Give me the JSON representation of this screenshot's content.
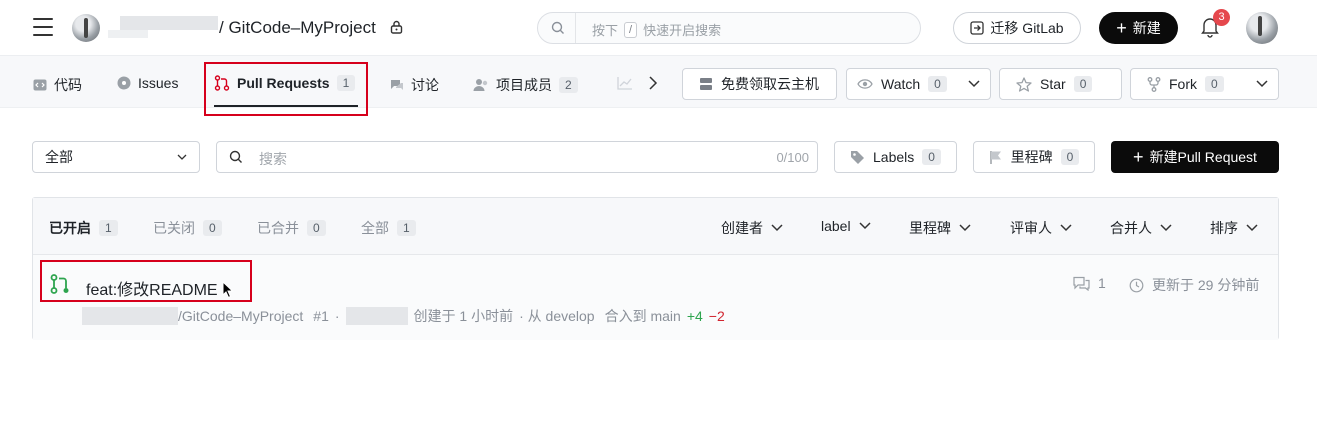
{
  "header": {
    "repo_path": "/ GitCode–MyProject",
    "search_hint_pre": "按下",
    "search_key": "/",
    "search_hint_post": "快速开启搜索",
    "migrate_label": "迁移 GitLab",
    "new_label": "新建",
    "notification_count": "3"
  },
  "tabs": {
    "code": "代码",
    "issues": "Issues",
    "pull_requests": "Pull Requests",
    "pull_requests_count": "1",
    "discuss": "讨论",
    "members": "项目成员",
    "members_count": "2"
  },
  "repo_actions": {
    "cloud_label": "免费领取云主机",
    "watch_label": "Watch",
    "watch_count": "0",
    "star_label": "Star",
    "star_count": "0",
    "fork_label": "Fork",
    "fork_count": "0"
  },
  "filters": {
    "scope_value": "全部",
    "search_placeholder": "搜索",
    "search_counter": "0/100",
    "labels_label": "Labels",
    "labels_count": "0",
    "milestone_label": "里程碑",
    "milestone_count": "0",
    "new_pr_label": "新建Pull Request"
  },
  "state_tabs": [
    {
      "label": "已开启",
      "count": "1"
    },
    {
      "label": "已关闭",
      "count": "0"
    },
    {
      "label": "已合并",
      "count": "0"
    },
    {
      "label": "全部",
      "count": "1"
    }
  ],
  "list_filters": {
    "creator": "创建者",
    "label": "label",
    "milestone": "里程碑",
    "reviewer": "评审人",
    "merger": "合并人",
    "sort": "排序"
  },
  "pull_request": {
    "title": "feat:修改README",
    "repo": "/GitCode–MyProject",
    "number": "#1",
    "sep": "·",
    "created": "创建于 1 小时前",
    "from": "· 从 develop",
    "merge_into": "合入到 main",
    "additions": "+4",
    "deletions": "−2",
    "comments": "1",
    "updated": "更新于 29 分钟前"
  },
  "colors": {
    "highlight_red": "#d6001c",
    "pr_icon_green": "#2da44e",
    "primary_black": "#0b0b0b"
  }
}
